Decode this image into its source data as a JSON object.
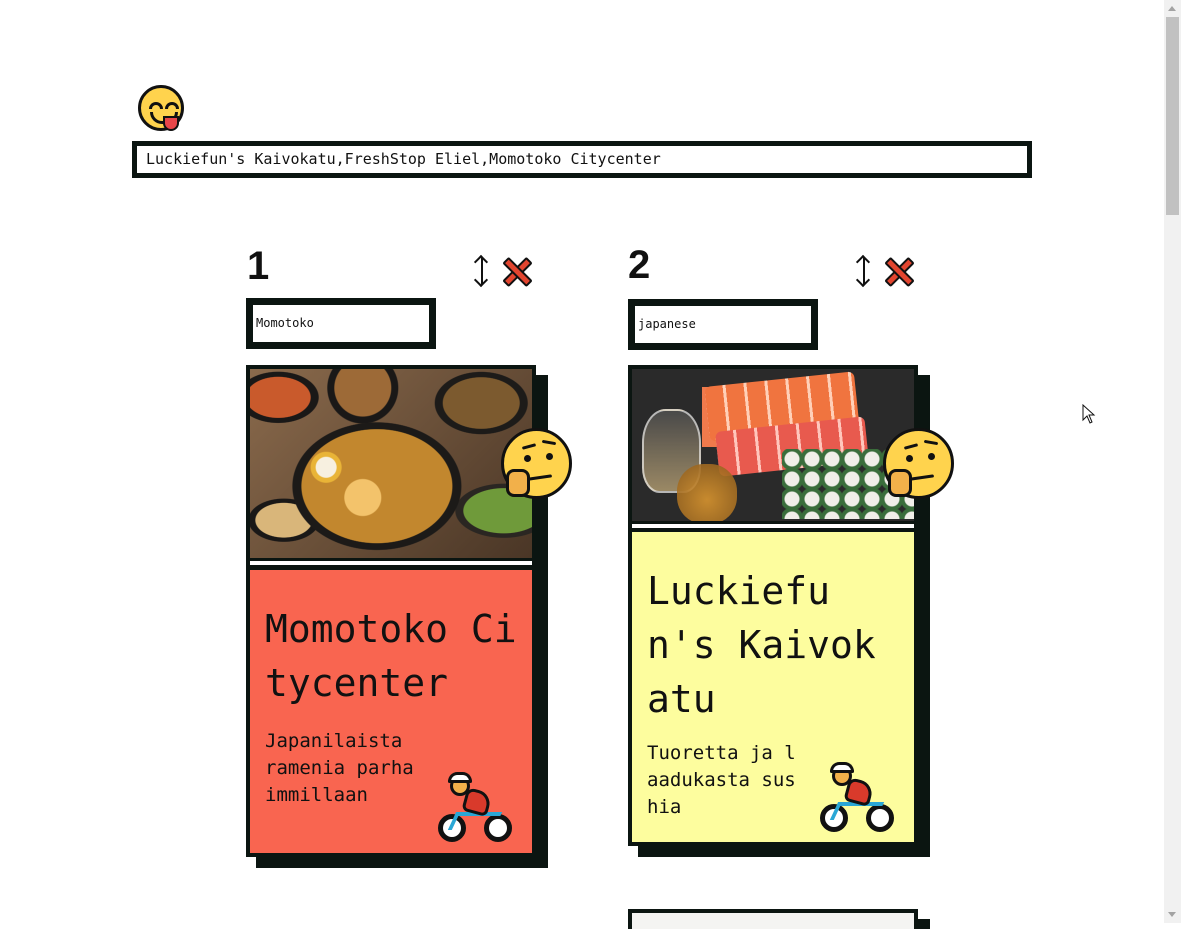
{
  "header": {
    "logo_icon": "yum-face-icon"
  },
  "search": {
    "value": "Luckiefun's Kaivokatu,FreshStop Eliel,Momotoko Citycenter"
  },
  "columns": [
    {
      "number": "1",
      "filter_value": "Momotoko",
      "card": {
        "title": "Momotoko Citycenter",
        "description": "Japanilaista ramenia parhaimmillaan",
        "color": "#f96550",
        "status_icon": "thinking-face-icon",
        "delivery_icon": "cyclist-icon"
      }
    },
    {
      "number": "2",
      "filter_value": "japanese",
      "card": {
        "title": "Luckiefun's Kaivokatu",
        "description": "Tuoretta ja laadukasta sushia",
        "color": "#fdfd9e",
        "status_icon": "thinking-face-icon",
        "delivery_icon": "cyclist-icon"
      }
    }
  ],
  "icons": {
    "sort": "sort-arrows-icon",
    "remove": "close-x-icon"
  },
  "colors": {
    "border": "#0b1511",
    "remove_red": "#e2452f",
    "card1": "#f96550",
    "card2": "#fdfd9e"
  }
}
